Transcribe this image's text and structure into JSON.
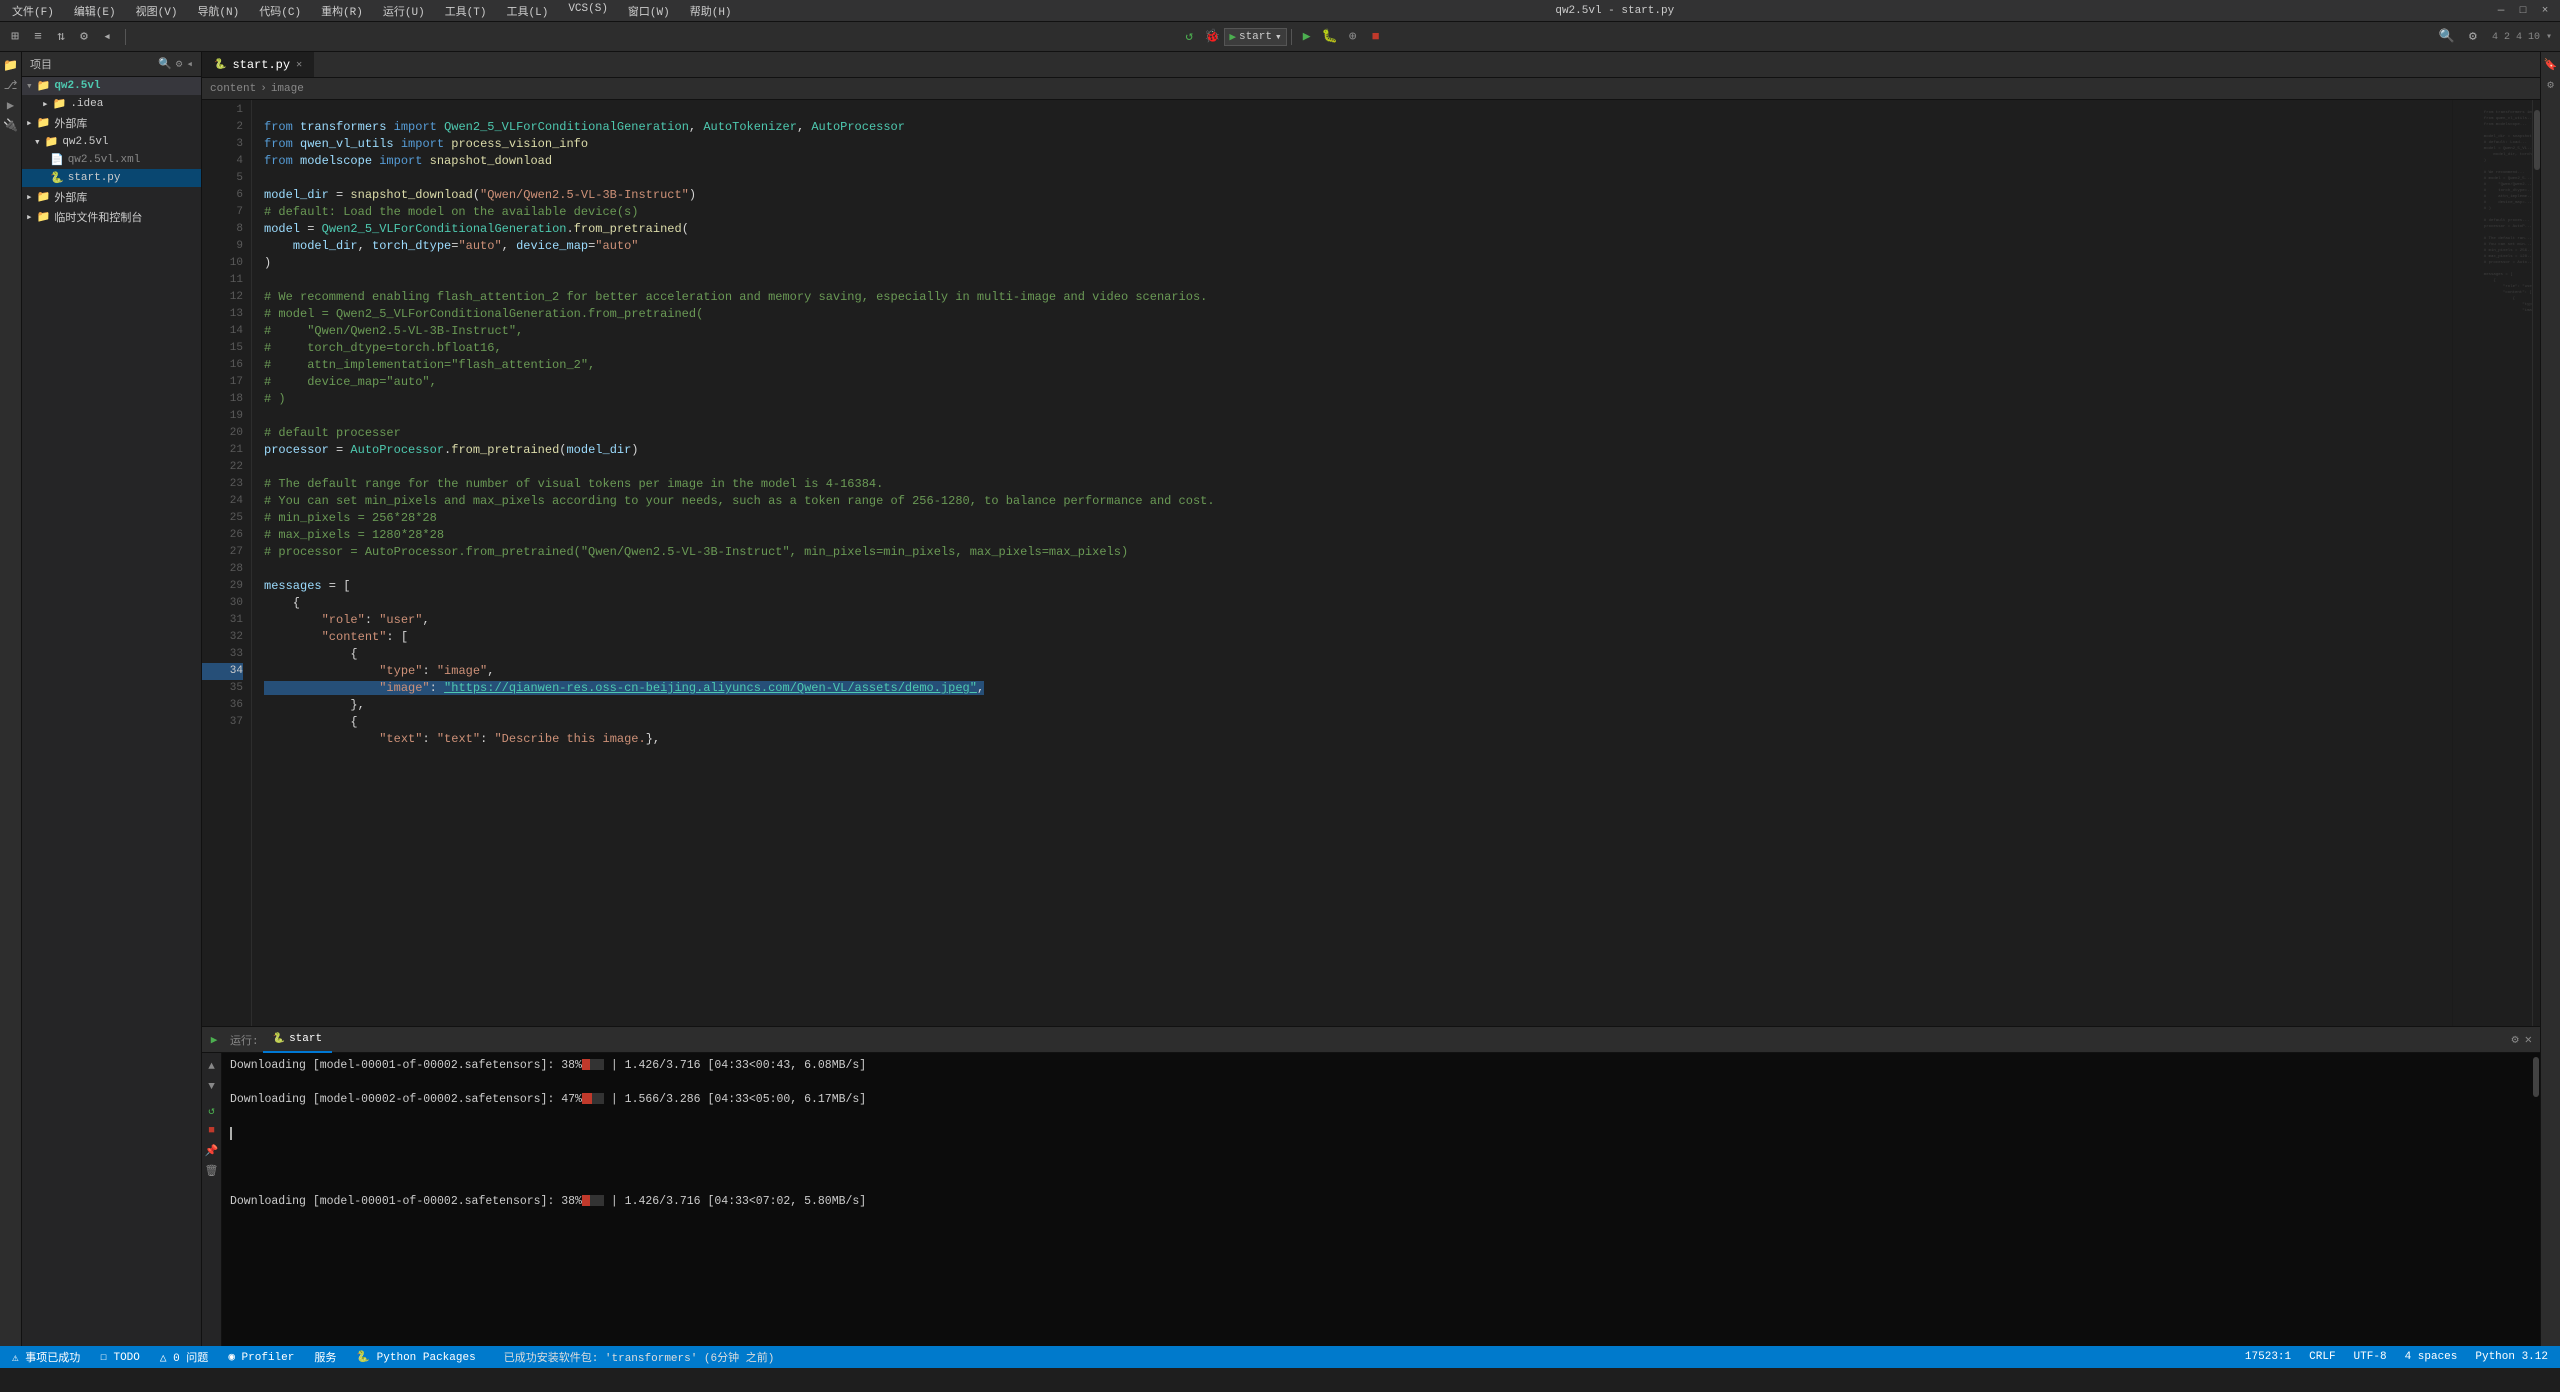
{
  "titlebar": {
    "menus": [
      "文件(F)",
      "编辑(E)",
      "视图(V)",
      "导航(N)",
      "代码(C)",
      "重构(R)",
      "运行(U)",
      "工具(T)",
      "工具(L)",
      "VCS(S)",
      "窗口(W)",
      "帮助(H)"
    ],
    "title": "qw2.5vl - start.py",
    "buttons": [
      "—",
      "□",
      "×"
    ]
  },
  "toolbar": {
    "project_name": "start",
    "run_label": "start",
    "icons": [
      "⊞",
      "≡",
      "↕",
      "⚙",
      "🔍"
    ]
  },
  "sidebar": {
    "title": "项目",
    "tree": [
      {
        "label": "qw2.5vl",
        "type": "project",
        "expanded": true,
        "indent": 0
      },
      {
        "label": ".idea",
        "type": "folder",
        "indent": 1
      },
      {
        "label": "外部库",
        "type": "folder",
        "indent": 0
      },
      {
        "label": "qw2.5vl",
        "type": "folder",
        "expanded": true,
        "indent": 1
      },
      {
        "label": "qw2.5vl.xml",
        "type": "xml",
        "indent": 2
      },
      {
        "label": "start.py",
        "type": "python",
        "indent": 2,
        "active": true
      },
      {
        "label": "外部库",
        "type": "folder",
        "indent": 0
      },
      {
        "label": "临时文件和控制台",
        "type": "folder",
        "indent": 0
      }
    ]
  },
  "editor": {
    "filename": "start.py",
    "breadcrumb": [
      "content",
      "image"
    ],
    "lines": [
      {
        "num": 1,
        "code": "from transformers import Qwen2_5_VLForConditionalGeneration, AutoTokenizer, AutoProcessor"
      },
      {
        "num": 2,
        "code": "from qwen_vl_utils import process_vision_info"
      },
      {
        "num": 3,
        "code": "from modelscope import snapshot_download"
      },
      {
        "num": 4,
        "code": ""
      },
      {
        "num": 5,
        "code": "model_dir = snapshot_download(\"Qwen/Qwen2.5-VL-3B-Instruct\")"
      },
      {
        "num": 6,
        "code": "# default: Load the model on the available device(s)"
      },
      {
        "num": 7,
        "code": "model = Qwen2_5_VLForConditionalGeneration.from_pretrained("
      },
      {
        "num": 8,
        "code": "    model_dir, torch_dtype=\"auto\", device_map=\"auto\""
      },
      {
        "num": 9,
        "code": ")"
      },
      {
        "num": 10,
        "code": ""
      },
      {
        "num": 11,
        "code": "# We recommend enabling flash_attention_2 for better acceleration and memory saving, especially in multi-image and video scenarios."
      },
      {
        "num": 12,
        "code": "# model = Qwen2_5_VLForConditionalGeneration.from_pretrained("
      },
      {
        "num": 13,
        "code": "#     \"Qwen/Qwen2.5-VL-3B-Instruct\","
      },
      {
        "num": 14,
        "code": "#     torch_dtype=torch.bfloat16,"
      },
      {
        "num": 15,
        "code": "#     attn_implementation=\"flash_attention_2\","
      },
      {
        "num": 16,
        "code": "#     device_map=\"auto\","
      },
      {
        "num": 17,
        "code": "# )"
      },
      {
        "num": 18,
        "code": ""
      },
      {
        "num": 19,
        "code": "# default processer"
      },
      {
        "num": 20,
        "code": "processor = AutoProcessor.from_pretrained(model_dir)"
      },
      {
        "num": 21,
        "code": ""
      },
      {
        "num": 22,
        "code": "# The default range for the number of visual tokens per image in the model is 4-16384."
      },
      {
        "num": 23,
        "code": "# You can set min_pixels and max_pixels according to your needs, such as a token range of 256-1280, to balance performance and cost."
      },
      {
        "num": 24,
        "code": "# min_pixels = 256*28*28"
      },
      {
        "num": 25,
        "code": "# max_pixels = 1280*28*28"
      },
      {
        "num": 26,
        "code": "# processor = AutoProcessor.from_pretrained(\"Qwen/Qwen2.5-VL-3B-Instruct\", min_pixels=min_pixels, max_pixels=max_pixels)"
      },
      {
        "num": 27,
        "code": ""
      },
      {
        "num": 28,
        "code": "messages = ["
      },
      {
        "num": 29,
        "code": "    {"
      },
      {
        "num": 30,
        "code": "        \"role\": \"user\","
      },
      {
        "num": 31,
        "code": "        \"content\": ["
      },
      {
        "num": 32,
        "code": "            {"
      },
      {
        "num": 33,
        "code": "                \"type\": \"image\","
      },
      {
        "num": 34,
        "code": "                \"image\": \"https://qianwen-res.oss-cn-beijing.aliyuncs.com/Qwen-VL/assets/demo.jpeg\","
      },
      {
        "num": 35,
        "code": "            },"
      },
      {
        "num": 36,
        "code": "            {"
      },
      {
        "num": 37,
        "code": "                \"text\": \"text\": \"Describe this image.\"},"
      }
    ]
  },
  "bottom": {
    "tabs": [
      "运行:",
      "start"
    ],
    "terminal_lines": [
      {
        "text": "Downloading [model-00001-of-00002.safetensors]:  38%|",
        "progress": 38,
        "suffix": "  | 1.426/3.716 [04:33<00:43, 6.08MB/s]"
      },
      {
        "text": ""
      },
      {
        "text": "Downloading [model-00002-of-00002.safetensors]:  47%|",
        "progress": 47,
        "suffix": "  | 1.566/3.286 [04:33<05:00, 6.17MB/s]"
      },
      {
        "text": ""
      },
      {
        "text": "Downloading [model-00001-of-00002.safetensors]:  38%|",
        "progress": 38,
        "suffix": "  | 1.426/3.716 [04:33<07:02, 5.80MB/s]"
      }
    ],
    "status_msg": "已成功安装软件包: 'transformers' (6分钟 之前)"
  },
  "statusbar": {
    "left": [],
    "right": [
      "17523:1",
      "CRLF",
      "UTF-8",
      "4 spaces",
      "Python 3.12"
    ]
  },
  "icons": {
    "folder": "📁",
    "file_py": "🐍",
    "file_xml": "📄",
    "run": "▶",
    "debug": "🐞",
    "search": "🔍",
    "settings": "⚙",
    "close": "✕",
    "chevron_right": "›",
    "chevron_down": "▾",
    "collapse": "◂",
    "warning": "⚠",
    "error": "✕",
    "info": "ℹ",
    "terminal": "⊞",
    "git": "⎇",
    "problems": "△"
  }
}
